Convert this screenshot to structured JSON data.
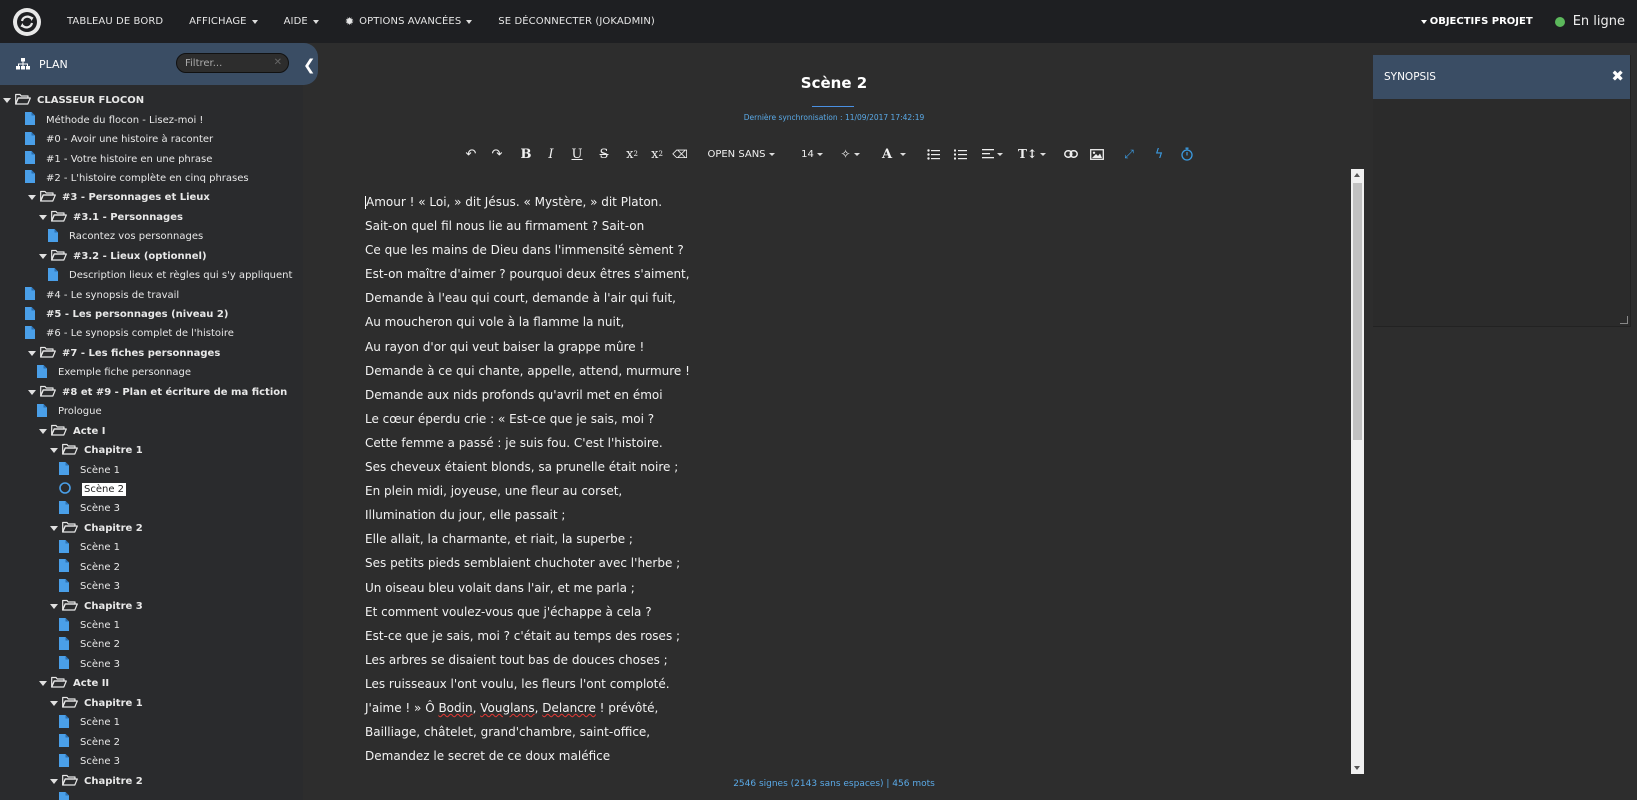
{
  "nav": {
    "items": [
      "TABLEAU DE BORD",
      "AFFICHAGE",
      "AIDE",
      "OPTIONS AVANCÉES",
      "SE DÉCONNECTER (JOKADMIN)"
    ],
    "objectifs": "OBJECTIFS PROJET",
    "status": "En ligne",
    "status_color": "#5cb85c"
  },
  "sidebar": {
    "title": "PLAN",
    "filter_placeholder": "Filtrer...",
    "tree": [
      {
        "label": "CLASSEUR FLOCON",
        "type": "folder",
        "depth": 0,
        "bold": true
      },
      {
        "label": "Méthode du flocon - Lisez-moi !",
        "type": "doc",
        "depth": 1
      },
      {
        "label": "#0 - Avoir une histoire à raconter",
        "type": "doc",
        "depth": 1
      },
      {
        "label": "#1 - Votre histoire en une phrase",
        "type": "doc",
        "depth": 1
      },
      {
        "label": "#2 - L'histoire complète en cinq phrases",
        "type": "doc",
        "depth": 1
      },
      {
        "label": "#3 - Personnages et Lieux",
        "type": "folder",
        "depth": 1,
        "bold": true
      },
      {
        "label": "#3.1 - Personnages",
        "type": "folder",
        "depth": 2,
        "bold": true
      },
      {
        "label": "Racontez vos personnages",
        "type": "doc",
        "depth": 3
      },
      {
        "label": "#3.2 - Lieux (optionnel)",
        "type": "folder",
        "depth": 2,
        "bold": true
      },
      {
        "label": "Description lieux et règles qui s'y appliquent",
        "type": "doc",
        "depth": 3
      },
      {
        "label": "#4 - Le synopsis de travail",
        "type": "doc",
        "depth": 1
      },
      {
        "label": "#5 - Les personnages (niveau 2)",
        "type": "doc",
        "depth": 1,
        "bold": true
      },
      {
        "label": "#6 - Le synopsis complet de l'histoire",
        "type": "doc",
        "depth": 1
      },
      {
        "label": "#7 - Les fiches personnages",
        "type": "folder",
        "depth": 1,
        "bold": true
      },
      {
        "label": "Exemple fiche personnage",
        "type": "doc",
        "depth": 2
      },
      {
        "label": "#8 et #9 - Plan et écriture de ma fiction",
        "type": "folder",
        "depth": 1,
        "bold": true
      },
      {
        "label": "Prologue",
        "type": "doc",
        "depth": 2
      },
      {
        "label": "Acte I",
        "type": "folder",
        "depth": 2,
        "bold": true
      },
      {
        "label": "Chapitre 1",
        "type": "folder",
        "depth": 3,
        "bold": true
      },
      {
        "label": "Scène 1",
        "type": "doc",
        "depth": 4
      },
      {
        "label": "Scène 2",
        "type": "circle",
        "depth": 4,
        "selected": true
      },
      {
        "label": "Scène 3",
        "type": "doc",
        "depth": 4
      },
      {
        "label": "Chapitre 2",
        "type": "folder",
        "depth": 3,
        "bold": true
      },
      {
        "label": "Scène 1",
        "type": "doc",
        "depth": 4
      },
      {
        "label": "Scène 2",
        "type": "doc",
        "depth": 4
      },
      {
        "label": "Scène 3",
        "type": "doc",
        "depth": 4
      },
      {
        "label": "Chapitre 3",
        "type": "folder",
        "depth": 3,
        "bold": true
      },
      {
        "label": "Scène 1",
        "type": "doc",
        "depth": 4
      },
      {
        "label": "Scène 2",
        "type": "doc",
        "depth": 4
      },
      {
        "label": "Scène 3",
        "type": "doc",
        "depth": 4
      },
      {
        "label": "Acte II",
        "type": "folder",
        "depth": 2,
        "bold": true
      },
      {
        "label": "Chapitre 1",
        "type": "folder",
        "depth": 3,
        "bold": true
      },
      {
        "label": "Scène 1",
        "type": "doc",
        "depth": 4
      },
      {
        "label": "Scène 2",
        "type": "doc",
        "depth": 4
      },
      {
        "label": "Scène 3",
        "type": "doc",
        "depth": 4
      },
      {
        "label": "Chapitre 2",
        "type": "folder",
        "depth": 3,
        "bold": true
      },
      {
        "label": "",
        "type": "doc",
        "depth": 4
      }
    ]
  },
  "editor": {
    "title": "Scène 2",
    "sync": "Dernière synchronisation : 11/09/2017 17:42:19",
    "font": "OPEN SANS",
    "size": "14",
    "lines": [
      "Amour ! « Loi, » dit Jésus. « Mystère, » dit Platon.",
      "Sait-on quel fil nous lie au firmament ? Sait-on",
      "Ce que les mains de Dieu dans l'immensité sèment ?",
      "Est-on maître d'aimer ? pourquoi deux êtres s'aiment,",
      "Demande à l'eau qui court, demande à l'air qui fuit,",
      "Au moucheron qui vole à la flamme la nuit,",
      "Au rayon d'or qui veut baiser la grappe mûre !",
      "Demande à ce qui chante, appelle, attend, murmure !",
      "Demande aux nids profonds qu'avril met en émoi",
      "Le cœur éperdu crie : « Est-ce que je sais, moi ?",
      "Cette femme a passé : je suis fou. C'est l'histoire.",
      "Ses cheveux étaient blonds, sa prunelle était noire ;",
      "En plein midi, joyeuse, une fleur au corset,",
      "Illumination du jour, elle passait ;",
      "Elle allait, la charmante, et riait, la superbe ;",
      "Ses petits pieds semblaient chuchoter avec l'herbe ;",
      "Un oiseau bleu volait dans l'air, et me parla ;",
      "Et comment voulez-vous que j'échappe à cela ?",
      "Est-ce que je sais, moi ? c'était au temps des roses ;",
      "Les arbres se disaient tout bas de douces choses ;",
      "Les ruisseaux l'ont voulu, les fleurs l'ont comploté.",
      "J'aime ! » Ô Bodin, Vouglans, Delancre ! prévôté,",
      "Bailliage, châtelet, grand'chambre, saint-office,",
      "Demandez le secret de ce doux maléfice"
    ],
    "wordcount": "2546 signes (2143 sans espaces) | 456 mots"
  },
  "synopsis": {
    "title": "SYNOPSIS",
    "close": "✖"
  }
}
